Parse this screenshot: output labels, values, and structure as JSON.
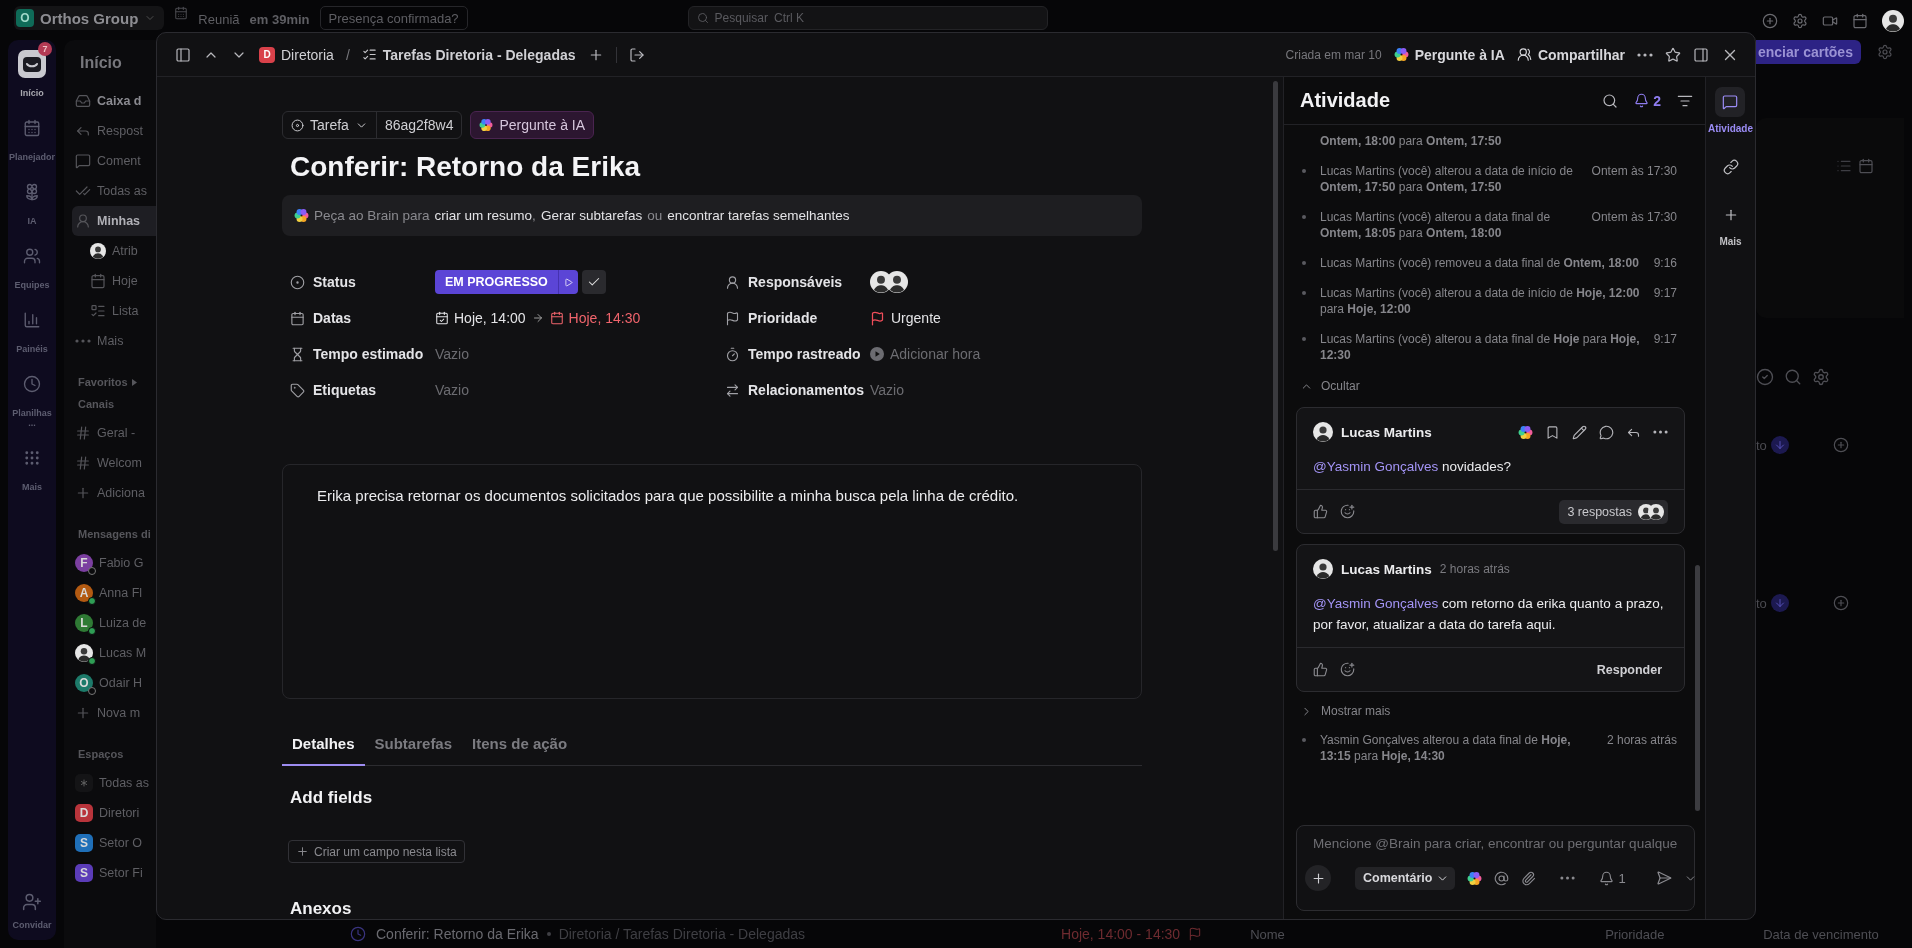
{
  "topbar": {
    "workspace": {
      "initial": "O",
      "name": "Orthos Group"
    },
    "meeting": {
      "title": "Reuniã",
      "time": "em 39min"
    },
    "meeting_prompt": "Presença confirmada?",
    "search": {
      "placeholder": "Pesquisar",
      "shortcut": "Ctrl K"
    }
  },
  "rail": {
    "items": [
      {
        "label": "Início",
        "badge": "7",
        "selected": true
      },
      {
        "label": "Planejador",
        "selected": false
      },
      {
        "label": "IA",
        "selected": false
      },
      {
        "label": "Equipes",
        "selected": false
      },
      {
        "label": "Painéis",
        "selected": false
      },
      {
        "label": "Planilhas ...",
        "selected": false
      },
      {
        "label": "Mais",
        "selected": false
      }
    ],
    "invite": "Convidar"
  },
  "sidebar": {
    "title": "Início",
    "items": [
      {
        "label": "Caixa d",
        "selected": false
      },
      {
        "label": "Respost",
        "selected": false
      },
      {
        "label": "Coment",
        "selected": false
      },
      {
        "label": "Todas as",
        "selected": false
      },
      {
        "label": "Minhas",
        "selected": true,
        "children": [
          {
            "label": "Atrib",
            "selected": false
          },
          {
            "label": "Hoje",
            "selected": false
          },
          {
            "label": "Lista",
            "selected": false
          }
        ]
      },
      {
        "label": "Mais",
        "selected": false
      }
    ],
    "favorites": "Favoritos",
    "channels": {
      "title": "Canais",
      "items": [
        {
          "label": "Geral -"
        },
        {
          "label": "Welcom"
        },
        {
          "label": "Adiciona"
        }
      ]
    },
    "messages": {
      "title": "Mensagens di",
      "items": [
        {
          "kind": "letter",
          "initial": "F",
          "name": "Fabio G",
          "color": "#7b3fa0",
          "online": false
        },
        {
          "kind": "letter",
          "initial": "A",
          "name": "Anna Fl",
          "color": "#b35a12",
          "online": true
        },
        {
          "kind": "letter",
          "initial": "L",
          "name": "Luiza de",
          "color": "#2f7a35",
          "online": true
        },
        {
          "kind": "photo",
          "name": "Lucas M",
          "online": true
        },
        {
          "kind": "letter",
          "initial": "O",
          "name": "Odair H",
          "color": "#1d7a6a",
          "online": false
        }
      ],
      "add": "Nova m"
    },
    "spaces": {
      "title": "Espaços",
      "items": [
        {
          "kind": "all",
          "name": "Todas as"
        },
        {
          "kind": "letter",
          "initial": "D",
          "name": "Diretori",
          "color": "#b8343b"
        },
        {
          "kind": "letter",
          "initial": "S",
          "name": "Setor O",
          "color": "#1f6fb8"
        },
        {
          "kind": "letter",
          "initial": "S",
          "name": "Setor Fi",
          "color": "#5b3cb8"
        }
      ]
    }
  },
  "modal": {
    "breadcrumb": {
      "space_initial": "D",
      "space": "Diretoria",
      "separator": "/",
      "list": "Tarefas Diretoria - Delegadas"
    },
    "created": "Criada em mar 10",
    "ask_ai": "Pergunte à IA",
    "share": "Compartilhar"
  },
  "task": {
    "type": "Tarefa",
    "id": "86ag2f8w4",
    "ask_ai": "Pergunte à IA",
    "title": "Conferir: Retorno da Erika",
    "brain_prompt": [
      {
        "text": "Peça ao Brain para",
        "link": false
      },
      {
        "text": "criar um resumo",
        "link": true
      },
      {
        "text": ",",
        "link": false
      },
      {
        "text": "Gerar subtarefas",
        "link": true
      },
      {
        "text": "ou",
        "link": false
      },
      {
        "text": "encontrar tarefas semelhantes",
        "link": true
      }
    ],
    "fields_left": [
      {
        "kind": "status",
        "label": "Status",
        "value": "EM PROGRESSO"
      },
      {
        "kind": "dates",
        "label": "Datas",
        "start": "Hoje, 14:00",
        "end": "Hoje, 14:30",
        "overdue": true
      },
      {
        "kind": "empty",
        "label": "Tempo estimado",
        "value": "Vazio"
      },
      {
        "kind": "empty",
        "label": "Etiquetas",
        "value": "Vazio"
      }
    ],
    "fields_right": [
      {
        "kind": "avatars",
        "label": "Responsáveis"
      },
      {
        "kind": "priority",
        "label": "Prioridade",
        "value": "Urgente"
      },
      {
        "kind": "timer",
        "label": "Tempo rastreado",
        "value": "Adicionar hora"
      },
      {
        "kind": "empty",
        "label": "Relacionamentos",
        "value": "Vazio"
      }
    ],
    "description": "Erika precisa retornar os documentos solicitados para que possibilite a minha busca pela linha de crédito.",
    "tabs": [
      {
        "label": "Detalhes",
        "selected": true
      },
      {
        "label": "Subtarefas",
        "selected": false
      },
      {
        "label": "Itens de ação",
        "selected": false
      }
    ],
    "add_fields": "Add fields",
    "create_field": "Criar um campo nesta lista",
    "attachments": "Anexos"
  },
  "activity": {
    "title": "Atividade",
    "notifications": "2",
    "feed": [
      {
        "kind": "change",
        "bullet": false,
        "text": "**Ontem, 18:00** para **Ontem, 17:50**"
      },
      {
        "kind": "change",
        "bullet": true,
        "text": "Lucas Martins (você) alterou a data de início de **Ontem, 17:50** para **Ontem, 17:50**",
        "time": "Ontem às 17:30"
      },
      {
        "kind": "change",
        "bullet": true,
        "text": "Lucas Martins (você) alterou a data final de **Ontem, 18:05** para **Ontem, 18:00**",
        "time": "Ontem às 17:30"
      },
      {
        "kind": "change",
        "bullet": true,
        "text": "Lucas Martins (você) removeu a data final de **Ontem, 18:00**",
        "time": "9:16"
      },
      {
        "kind": "change",
        "bullet": true,
        "text": "Lucas Martins (você) alterou a data de início de **Hoje, 12:00** para **Hoje, 12:00**",
        "time": "9:17"
      },
      {
        "kind": "change",
        "bullet": true,
        "text": "Lucas Martins (você) alterou a data final de **Hoje** para **Hoje, 12:30**",
        "time": "9:17"
      },
      {
        "kind": "toggle",
        "label": "Ocultar",
        "expanded": true
      },
      {
        "kind": "comment",
        "author": "Lucas Martins",
        "mention": "@Yasmin Gonçalves",
        "text": "novidades?",
        "replies": "3 respostas"
      },
      {
        "kind": "comment",
        "author": "Lucas Martins",
        "time": "2 horas atrás",
        "mention": "@Yasmin Gonçalves",
        "text": "com retorno da erika quanto a prazo, por favor, atualizar a data do tarefa aqui.",
        "action": "Responder"
      },
      {
        "kind": "toggle",
        "label": "Mostrar mais",
        "expanded": false
      },
      {
        "kind": "change",
        "bullet": true,
        "text": "Yasmin Gonçalves alterou a data final de **Hoje, 13:15** para **Hoje, 14:30**",
        "time": "2 horas atrás"
      }
    ],
    "composer": {
      "placeholder": "Mencione @Brain para criar, encontrar ou perguntar qualque",
      "type": "Comentário",
      "watchers": "1"
    }
  },
  "side_rail": [
    {
      "label": "Atividade",
      "selected": true
    },
    {
      "selected": false
    },
    {
      "label": "Mais",
      "selected": false
    }
  ],
  "background": {
    "manage_cards": "enciar cartões",
    "column_fragments": [
      "to",
      "to"
    ],
    "row": {
      "title": "Conferir: Retorno da Erika",
      "path": "Diretoria / Tarefas Diretoria - Delegadas",
      "dates": "Hoje, 14:00 - 14:30"
    },
    "columns": [
      "Nome",
      "Prioridade",
      "Data de vencimento"
    ]
  }
}
